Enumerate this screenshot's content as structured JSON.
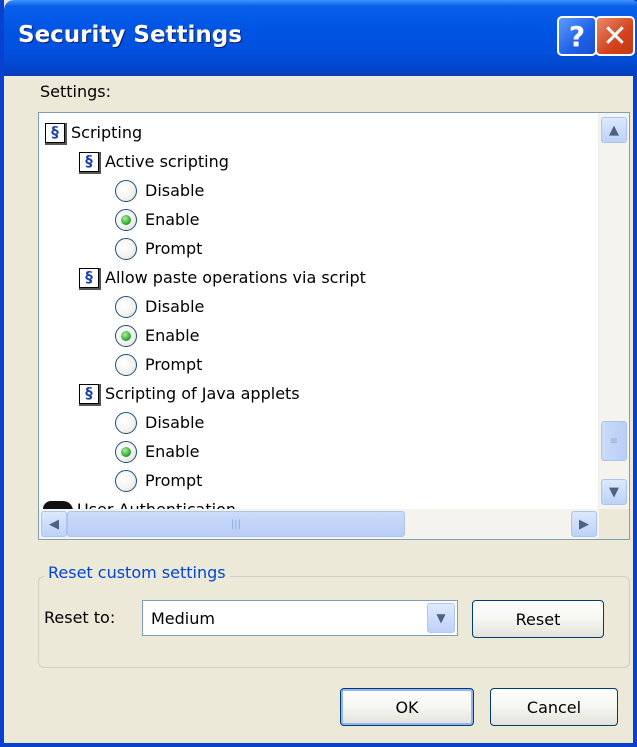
{
  "window": {
    "title": "Security Settings",
    "help_glyph": "?",
    "close_glyph": "✕"
  },
  "settings_label": "Settings:",
  "tree": {
    "category": "Scripting",
    "settings": [
      {
        "label": "Active scripting",
        "options": [
          "Disable",
          "Enable",
          "Prompt"
        ],
        "selected": "Enable"
      },
      {
        "label": "Allow paste operations via script",
        "options": [
          "Disable",
          "Enable",
          "Prompt"
        ],
        "selected": "Enable"
      },
      {
        "label": "Scripting of Java applets",
        "options": [
          "Disable",
          "Enable",
          "Prompt"
        ],
        "selected": "Enable"
      }
    ],
    "next_category": "User Authentication"
  },
  "reset_group": {
    "title": "Reset custom settings",
    "reset_to_label": "Reset to:",
    "selected_level": "Medium",
    "reset_button": "Reset"
  },
  "buttons": {
    "ok": "OK",
    "cancel": "Cancel"
  },
  "colors": {
    "title_bar": "#0054E3",
    "group_title": "#0046D5",
    "selected_radio": "#21A121"
  }
}
